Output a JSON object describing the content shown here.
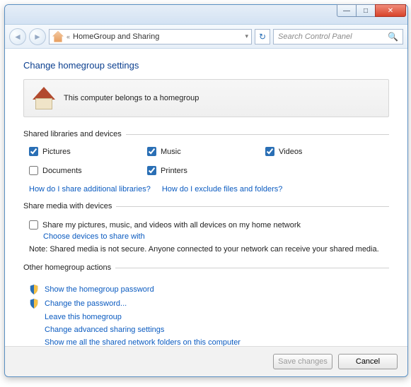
{
  "titlebar": {
    "min": "—",
    "max": "□",
    "close": "✕"
  },
  "nav": {
    "back": "◄",
    "forward": "►",
    "crumb_prefix": "«",
    "breadcrumb": "HomeGroup and Sharing",
    "dropdown": "▾",
    "refresh": "↻",
    "search_placeholder": "Search Control Panel",
    "search_icon": "🔍"
  },
  "heading": "Change homegroup settings",
  "banner_text": "This computer belongs to a homegroup",
  "libs": {
    "legend": "Shared libraries and devices",
    "items": [
      {
        "label": "Pictures",
        "checked": true
      },
      {
        "label": "Music",
        "checked": true
      },
      {
        "label": "Videos",
        "checked": true
      },
      {
        "label": "Documents",
        "checked": false
      },
      {
        "label": "Printers",
        "checked": true
      }
    ],
    "link_more": "How do I share additional libraries?",
    "link_exclude": "How do I exclude files and folders?"
  },
  "media": {
    "legend": "Share media with devices",
    "check_label": "Share my pictures, music, and videos with all devices on my home network",
    "checked": false,
    "choose_link": "Choose devices to share with",
    "note": "Note: Shared media is not secure. Anyone connected to your network can receive your shared media."
  },
  "other": {
    "legend": "Other homegroup actions",
    "show_pw": "Show the homegroup password",
    "change_pw": "Change the password...",
    "leave": "Leave this homegroup",
    "advanced": "Change advanced sharing settings",
    "show_all": "Show me all the shared network folders on this computer"
  },
  "footer": {
    "save": "Save changes",
    "cancel": "Cancel"
  }
}
